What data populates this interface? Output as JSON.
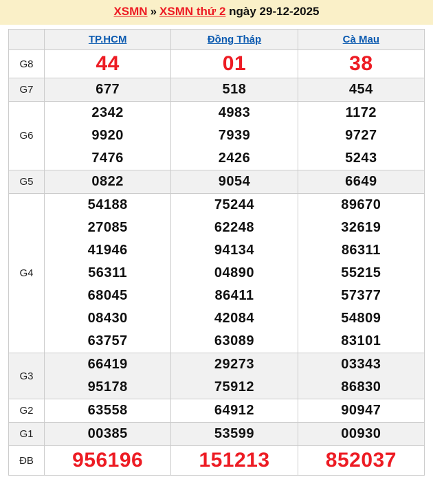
{
  "title": {
    "link1": "XSMN",
    "separator": "»",
    "link2": "XSMN thứ 2",
    "suffix": "ngày 29-12-2025"
  },
  "colors": {
    "banner_bg": "#FAF0C8",
    "result_red": "#ED1C24",
    "link_blue": "#0B5AB0",
    "row_shade": "#F1F1F1",
    "border": "#CCCCCC"
  },
  "table": {
    "columns": [
      "TP.HCM",
      "Đồng Tháp",
      "Cà Mau"
    ],
    "rows": [
      {
        "id": "g8",
        "label": "G8",
        "style": "big-red",
        "shaded": false,
        "cells": [
          [
            "44"
          ],
          [
            "01"
          ],
          [
            "38"
          ]
        ]
      },
      {
        "id": "g7",
        "label": "G7",
        "style": "normal",
        "shaded": true,
        "cells": [
          [
            "677"
          ],
          [
            "518"
          ],
          [
            "454"
          ]
        ]
      },
      {
        "id": "g6",
        "label": "G6",
        "style": "normal",
        "shaded": false,
        "cells": [
          [
            "2342",
            "9920",
            "7476"
          ],
          [
            "4983",
            "7939",
            "2426"
          ],
          [
            "1172",
            "9727",
            "5243"
          ]
        ]
      },
      {
        "id": "g5",
        "label": "G5",
        "style": "normal",
        "shaded": true,
        "cells": [
          [
            "0822"
          ],
          [
            "9054"
          ],
          [
            "6649"
          ]
        ]
      },
      {
        "id": "g4",
        "label": "G4",
        "style": "normal",
        "shaded": false,
        "cells": [
          [
            "54188",
            "27085",
            "41946",
            "56311",
            "68045",
            "08430",
            "63757"
          ],
          [
            "75244",
            "62248",
            "94134",
            "04890",
            "86411",
            "42084",
            "63089"
          ],
          [
            "89670",
            "32619",
            "86311",
            "55215",
            "57377",
            "54809",
            "83101"
          ]
        ]
      },
      {
        "id": "g3",
        "label": "G3",
        "style": "normal",
        "shaded": true,
        "cells": [
          [
            "66419",
            "95178"
          ],
          [
            "29273",
            "75912"
          ],
          [
            "03343",
            "86830"
          ]
        ]
      },
      {
        "id": "g2",
        "label": "G2",
        "style": "normal",
        "shaded": false,
        "cells": [
          [
            "63558"
          ],
          [
            "64912"
          ],
          [
            "90947"
          ]
        ]
      },
      {
        "id": "g1",
        "label": "G1",
        "style": "normal",
        "shaded": true,
        "cells": [
          [
            "00385"
          ],
          [
            "53599"
          ],
          [
            "00930"
          ]
        ]
      },
      {
        "id": "db",
        "label": "ĐB",
        "style": "big-red",
        "shaded": false,
        "cells": [
          [
            "956196"
          ],
          [
            "151213"
          ],
          [
            "852037"
          ]
        ]
      }
    ]
  }
}
